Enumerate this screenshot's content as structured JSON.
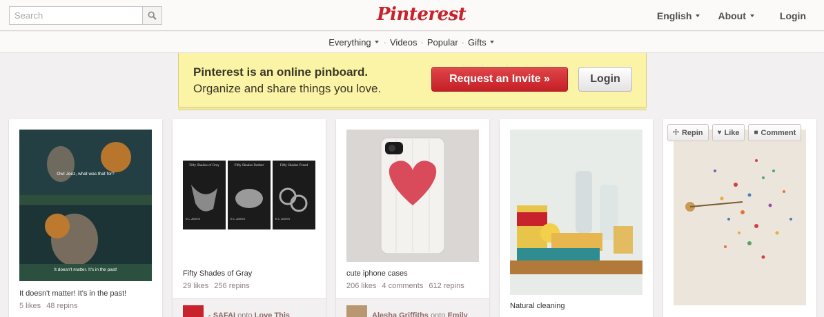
{
  "search": {
    "placeholder": "Search"
  },
  "brand": {
    "logo_text": "Pinterest",
    "color": "#c8232c"
  },
  "top_nav": {
    "language": "English",
    "about": "About",
    "login": "Login"
  },
  "sub_nav": {
    "everything": "Everything",
    "videos": "Videos",
    "popular": "Popular",
    "gifts": "Gifts",
    "separator": "·"
  },
  "banner": {
    "line1": "Pinterest is an online pinboard.",
    "line2": "Organize and share things you love.",
    "invite_button": "Request an Invite »",
    "login_button": "Login"
  },
  "pins": [
    {
      "description": "It doesn't matter! It's in the past!",
      "likes": "5 likes",
      "repins": "48 repins",
      "image_texts": [
        "Ow! Jeez, what was that for?",
        "It doesn't matter. It's in the past!"
      ]
    },
    {
      "description": "Fifty Shades of Gray",
      "likes": "29 likes",
      "repins": "256 repins",
      "book_titles": [
        "Fifty Shades of Grey",
        "Fifty Shades Darker",
        "Fifty Shades Freed"
      ],
      "book_author": "E L James",
      "footer_user": "- SAFAI",
      "footer_onto": "onto",
      "footer_board": "Love This"
    },
    {
      "description": "cute iphone cases",
      "likes": "206 likes",
      "comments": "4 comments",
      "repins": "612 repins",
      "footer_user": "Alesha Griffiths",
      "footer_onto": "onto",
      "footer_board": "Emily"
    },
    {
      "description": "Natural cleaning"
    },
    {
      "actions": {
        "repin": "Repin",
        "like": "Like",
        "comment": "Comment"
      }
    }
  ],
  "colors": {
    "accent": "#c8232c",
    "background": "#f2f0f0",
    "banner": "#fbf4a6"
  }
}
